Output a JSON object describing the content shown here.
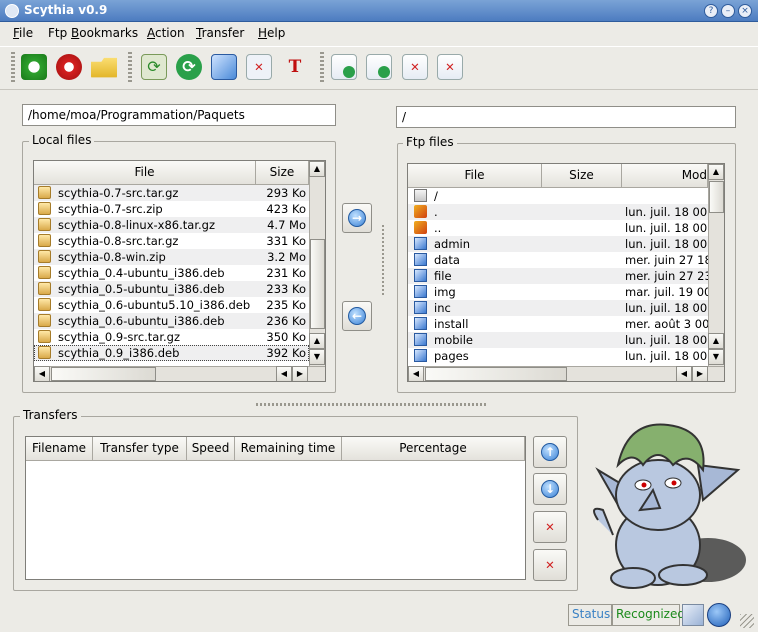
{
  "window": {
    "title": "Scythia v0.9"
  },
  "menu": {
    "items": [
      "File",
      "Ftp Bookmarks",
      "Action",
      "Transfer",
      "Help"
    ],
    "underline": [
      "F",
      "B",
      "A",
      "T",
      "H"
    ]
  },
  "toolbar": {
    "icons": [
      "connect-icon",
      "disconnect-icon",
      "open-folder-icon",
      "refresh-local-icon",
      "refresh-remote-icon",
      "edit-bookmarks-icon",
      "delete-bookmark-icon",
      "text-tool-icon",
      "download-icon",
      "upload-icon",
      "remove-file-icon",
      "clear-queue-icon"
    ]
  },
  "local": {
    "path": "/home/moa/Programmation/Paquets",
    "group_label": "Local files",
    "columns": [
      "File",
      "Size"
    ],
    "rows": [
      {
        "name": "scythia-0.7-src.tar.gz",
        "size": "293 Ko"
      },
      {
        "name": "scythia-0.7-src.zip",
        "size": "423 Ko"
      },
      {
        "name": "scythia-0.8-linux-x86.tar.gz",
        "size": "4.7 Mo"
      },
      {
        "name": "scythia-0.8-src.tar.gz",
        "size": "331 Ko"
      },
      {
        "name": "scythia-0.8-win.zip",
        "size": "3.2 Mo"
      },
      {
        "name": "scythia_0.4-ubuntu_i386.deb",
        "size": "231 Ko"
      },
      {
        "name": "scythia_0.5-ubuntu_i386.deb",
        "size": "233 Ko"
      },
      {
        "name": "scythia_0.6-ubuntu5.10_i386.deb",
        "size": "235 Ko"
      },
      {
        "name": "scythia_0.6-ubuntu_i386.deb",
        "size": "236 Ko"
      },
      {
        "name": "scythia_0.9-src.tar.gz",
        "size": "350 Ko"
      },
      {
        "name": "scythia_0.9_i386.deb",
        "size": "392 Ko"
      }
    ]
  },
  "remote": {
    "path": "/",
    "group_label": "Ftp files",
    "columns": [
      "File",
      "Size",
      "Mod"
    ],
    "rows": [
      {
        "name": "/",
        "size": "",
        "mod": "",
        "kind": "root"
      },
      {
        "name": ".",
        "size": "",
        "mod": "lun. juil. 18 00:",
        "kind": "special"
      },
      {
        "name": "..",
        "size": "",
        "mod": "lun. juil. 18 00:",
        "kind": "special"
      },
      {
        "name": "admin",
        "size": "",
        "mod": "lun. juil. 18 00:",
        "kind": "folder"
      },
      {
        "name": "data",
        "size": "",
        "mod": "mer. juin 27 18",
        "kind": "folder"
      },
      {
        "name": "file",
        "size": "",
        "mod": "mer. juin 27 23",
        "kind": "folder"
      },
      {
        "name": "img",
        "size": "",
        "mod": "mar. juil. 19 00:",
        "kind": "folder"
      },
      {
        "name": "inc",
        "size": "",
        "mod": "lun. juil. 18 00:",
        "kind": "folder"
      },
      {
        "name": "install",
        "size": "",
        "mod": "mer. août 3 00:",
        "kind": "folder"
      },
      {
        "name": "mobile",
        "size": "",
        "mod": "lun. juil. 18 00:",
        "kind": "folder"
      },
      {
        "name": "pages",
        "size": "",
        "mod": "lun. juil. 18 00:",
        "kind": "folder"
      }
    ]
  },
  "transfers": {
    "group_label": "Transfers",
    "columns": [
      "Filename",
      "Transfer type",
      "Speed",
      "Remaining time",
      "Percentage"
    ]
  },
  "status": {
    "label": "Status:",
    "value": "Recognized"
  },
  "colors": {
    "titlebar": "#4d7cc0",
    "status_ok": "#1a8a1a",
    "status_label": "#3b82c4"
  }
}
